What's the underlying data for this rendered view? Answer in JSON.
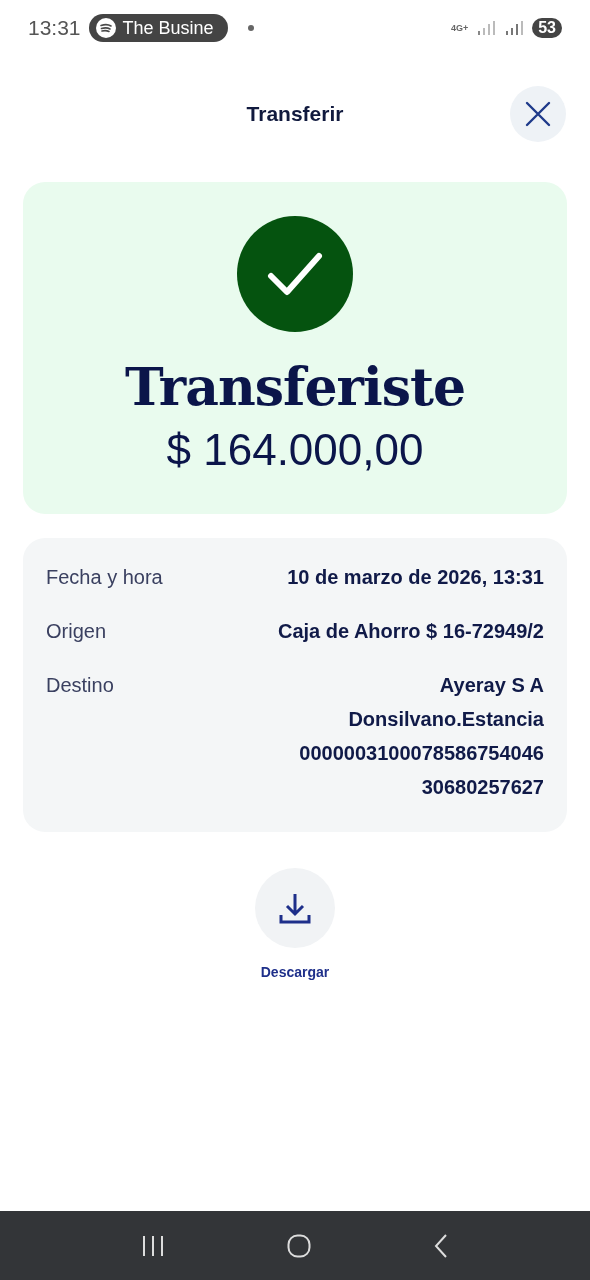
{
  "status_bar": {
    "time": "13:31",
    "media_chip": "The Busine",
    "network": "4G+",
    "battery": "53"
  },
  "header": {
    "title": "Transferir"
  },
  "success": {
    "headline": "Transferiste",
    "amount": "$ 164.000,00"
  },
  "details": [
    {
      "label": "Fecha y hora",
      "values": [
        "10 de marzo de 2026, 13:31"
      ]
    },
    {
      "label": "Origen",
      "values": [
        "Caja de Ahorro $ 16-72949/2"
      ]
    },
    {
      "label": "Destino",
      "values": [
        "Ayeray S A",
        "Donsilvano.Estancia",
        "0000003100078586754046",
        "30680257627"
      ]
    }
  ],
  "actions": [
    {
      "label": "Descargar"
    }
  ]
}
